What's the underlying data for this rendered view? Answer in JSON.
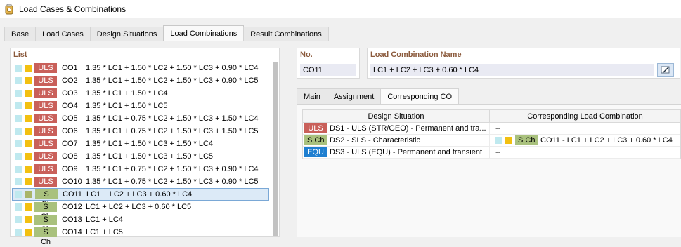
{
  "window": {
    "title": "Load Cases & Combinations"
  },
  "tabs": [
    "Base",
    "Load Cases",
    "Design Situations",
    "Load Combinations",
    "Result Combinations"
  ],
  "active_tab": "Load Combinations",
  "list": {
    "header": "List",
    "rows": [
      {
        "tag": "ULS",
        "co": "CO1",
        "formula": "1.35 * LC1 + 1.50 * LC2 + 1.50 * LC3 + 0.90 * LC4"
      },
      {
        "tag": "ULS",
        "co": "CO2",
        "formula": "1.35 * LC1 + 1.50 * LC2 + 1.50 * LC3 + 0.90 * LC5"
      },
      {
        "tag": "ULS",
        "co": "CO3",
        "formula": "1.35 * LC1 + 1.50 * LC4"
      },
      {
        "tag": "ULS",
        "co": "CO4",
        "formula": "1.35 * LC1 + 1.50 * LC5"
      },
      {
        "tag": "ULS",
        "co": "CO5",
        "formula": "1.35 * LC1 + 0.75 * LC2 + 1.50 * LC3 + 1.50 * LC4"
      },
      {
        "tag": "ULS",
        "co": "CO6",
        "formula": "1.35 * LC1 + 0.75 * LC2 + 1.50 * LC3 + 1.50 * LC5"
      },
      {
        "tag": "ULS",
        "co": "CO7",
        "formula": "1.35 * LC1 + 1.50 * LC3 + 1.50 * LC4"
      },
      {
        "tag": "ULS",
        "co": "CO8",
        "formula": "1.35 * LC1 + 1.50 * LC3 + 1.50 * LC5"
      },
      {
        "tag": "ULS",
        "co": "CO9",
        "formula": "1.35 * LC1 + 0.75 * LC2 + 1.50 * LC3 + 0.90 * LC4"
      },
      {
        "tag": "ULS",
        "co": "CO10",
        "formula": "1.35 * LC1 + 0.75 * LC2 + 1.50 * LC3 + 0.90 * LC5"
      },
      {
        "tag": "S Ch",
        "co": "CO11",
        "formula": "LC1 + LC2 + LC3 + 0.60 * LC4"
      },
      {
        "tag": "S Ch",
        "co": "CO12",
        "formula": "LC1 + LC2 + LC3 + 0.60 * LC5"
      },
      {
        "tag": "S Ch",
        "co": "CO13",
        "formula": "LC1 + LC4"
      },
      {
        "tag": "S Ch",
        "co": "CO14",
        "formula": "LC1 + LC5"
      }
    ]
  },
  "no": {
    "label": "No.",
    "value": "CO11"
  },
  "name": {
    "label": "Load Combination Name",
    "value": "LC1 + LC2 + LC3 + 0.60 * LC4"
  },
  "subtabs": [
    "Main",
    "Assignment",
    "Corresponding CO"
  ],
  "active_subtab": "Corresponding CO",
  "grid": {
    "col1": "Design Situation",
    "col2": "Corresponding Load Combination",
    "rows": [
      {
        "tag": "ULS",
        "ds": "DS1 - ULS (STR/GEO) - Permanent and tra...",
        "corr": "--"
      },
      {
        "tag": "S Ch",
        "ds": "DS2 - SLS - Characteristic",
        "corr": "CO11 - LC1 + LC2 + LC3 + 0.60 * LC4"
      },
      {
        "tag": "EQU",
        "ds": "DS3 - ULS (EQU) - Permanent and transient",
        "corr": "--"
      }
    ]
  },
  "colors": {
    "uls": "#c9605a",
    "sch": "#a9c17d",
    "equ": "#1f7fd0",
    "accent_header": "#8b5a3c"
  }
}
